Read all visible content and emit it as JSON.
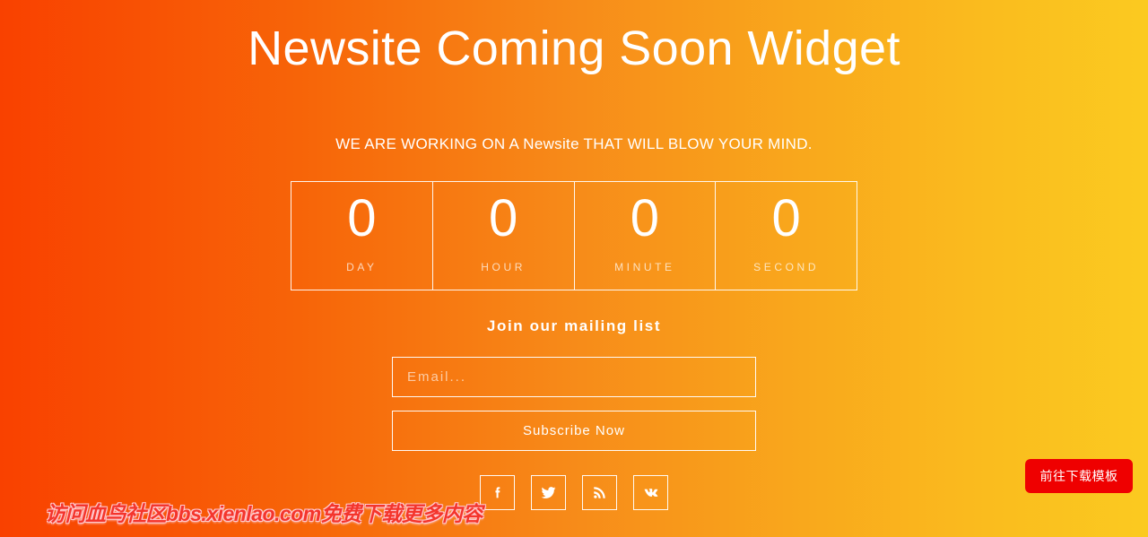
{
  "theme": {
    "gradient_start": "#f94100",
    "gradient_mid": "#f78b19",
    "gradient_end": "#fbca20",
    "text_color": "#ffffff",
    "download_button_color": "#ef0000",
    "watermark_color": "#f4352c"
  },
  "header": {
    "title": "Newsite Coming Soon Widget",
    "subtitle": "WE ARE WORKING ON A Newsite THAT WILL BLOW YOUR MIND."
  },
  "countdown": {
    "units": [
      {
        "value": "0",
        "label": "DAY"
      },
      {
        "value": "0",
        "label": "HOUR"
      },
      {
        "value": "0",
        "label": "MINUTE"
      },
      {
        "value": "0",
        "label": "SECOND"
      }
    ]
  },
  "mailing": {
    "title": "Join our mailing list",
    "email_placeholder": "Email...",
    "email_value": "",
    "subscribe_label": "Subscribe Now"
  },
  "social": {
    "items": [
      {
        "icon": "facebook-icon"
      },
      {
        "icon": "twitter-icon"
      },
      {
        "icon": "rss-icon"
      },
      {
        "icon": "vk-icon"
      }
    ]
  },
  "overlay": {
    "watermark_text": "访问血鸟社区bbs.xienlao.com免费下载更多内容",
    "download_button_label": "前往下载模板"
  }
}
